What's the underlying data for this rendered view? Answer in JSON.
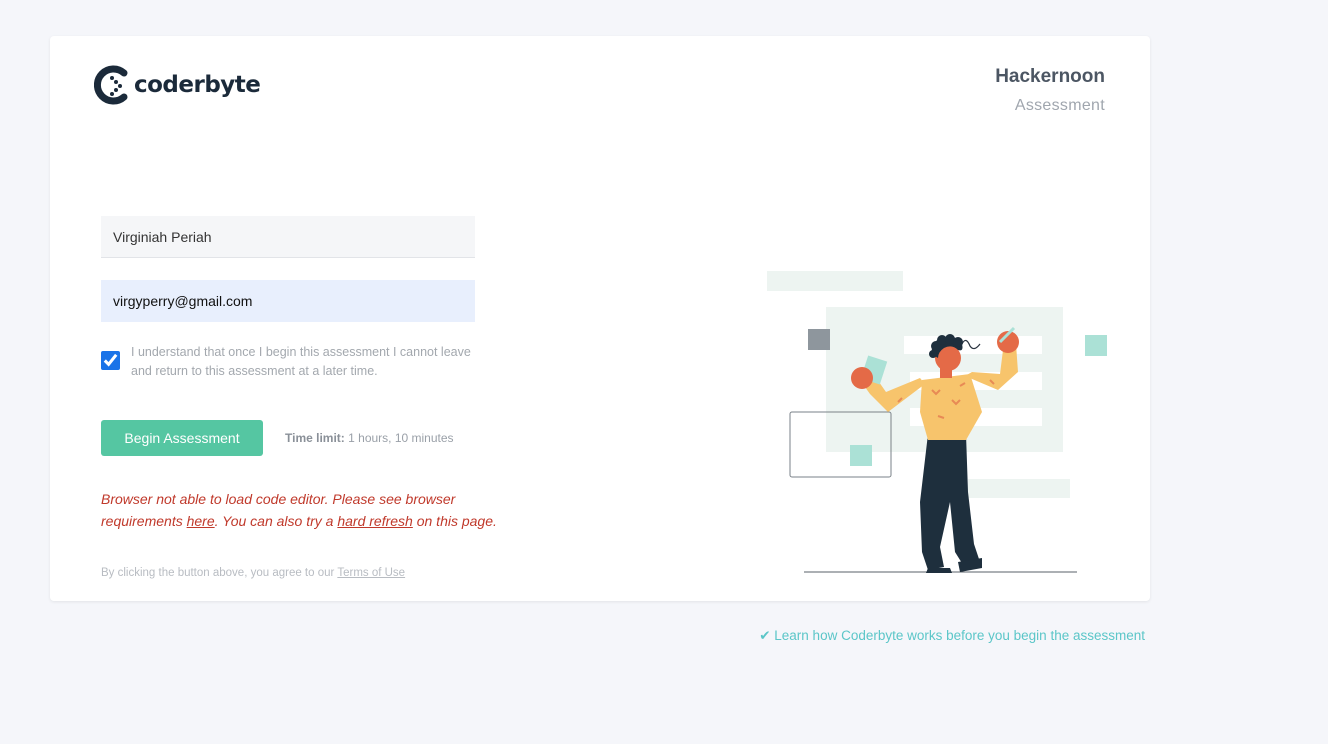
{
  "brand": {
    "logo_text": "coderbyte"
  },
  "company": {
    "name": "Hackernoon",
    "subtitle": "Assessment"
  },
  "form": {
    "name_value": "Virginiah Periah",
    "email_value": "virgyperry@gmail.com",
    "agree_checked": true,
    "agree_text": "I understand that once I begin this assessment I cannot leave and return to this assessment at a later time.",
    "begin_label": "Begin Assessment",
    "time_limit_label": "Time limit:",
    "time_limit_value": "1 hours, 10 minutes"
  },
  "error": {
    "part1": "Browser not able to load code editor. Please see browser requirements ",
    "link1": "here",
    "part2": ". You can also try a ",
    "link2": "hard refresh",
    "part3": " on this page."
  },
  "terms": {
    "prefix": "By clicking the button above, you agree to our ",
    "link": "Terms of Use"
  },
  "footer": {
    "learn_link": "✔ Learn how Coderbyte works before you begin the assessment"
  },
  "colors": {
    "accent": "#55c6a2",
    "error": "#c0392b",
    "link": "#5bc6c8",
    "brand_dark": "#1b2a3a"
  },
  "illustration": {
    "icon": "person-writing-illustration"
  }
}
